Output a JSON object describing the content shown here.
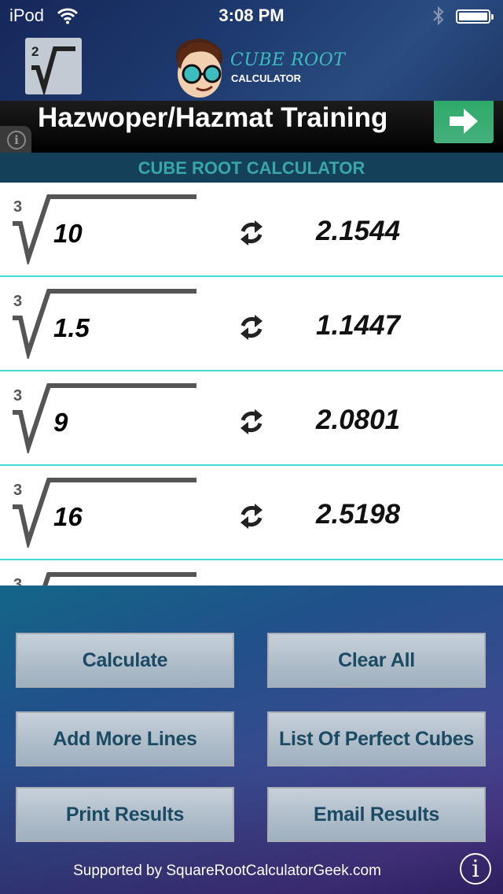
{
  "status_bar": {
    "carrier": "iPod",
    "time": "3:08 PM"
  },
  "header": {
    "square_root_index": "2",
    "logo_title": "CUBE ROOT",
    "logo_subtitle": "CALCULATOR"
  },
  "ad": {
    "text": "Hazwoper/Hazmat Training",
    "info_icon": "i"
  },
  "banner": {
    "title": "CUBE ROOT CALCULATOR"
  },
  "rows": [
    {
      "index": "3",
      "operand": "10",
      "result": "2.1544"
    },
    {
      "index": "3",
      "operand": "1.5",
      "result": "1.1447"
    },
    {
      "index": "3",
      "operand": "9",
      "result": "2.0801"
    },
    {
      "index": "3",
      "operand": "16",
      "result": "2.5198"
    },
    {
      "index": "3",
      "operand": "",
      "result": ""
    }
  ],
  "buttons": {
    "calculate": "Calculate",
    "clear_all": "Clear All",
    "add_more_lines": "Add More Lines",
    "list_perfect_cubes": "List Of Perfect Cubes",
    "print_results": "Print Results",
    "email_results": "Email Results"
  },
  "footer": {
    "supported_by": "Supported by SquareRootCalculatorGeek.com",
    "info_icon": "i"
  },
  "colors": {
    "accent_teal": "#3fdada",
    "button_text": "#1b4a63",
    "banner_bg": "#14405a",
    "ad_button": "#2eaa6a"
  }
}
